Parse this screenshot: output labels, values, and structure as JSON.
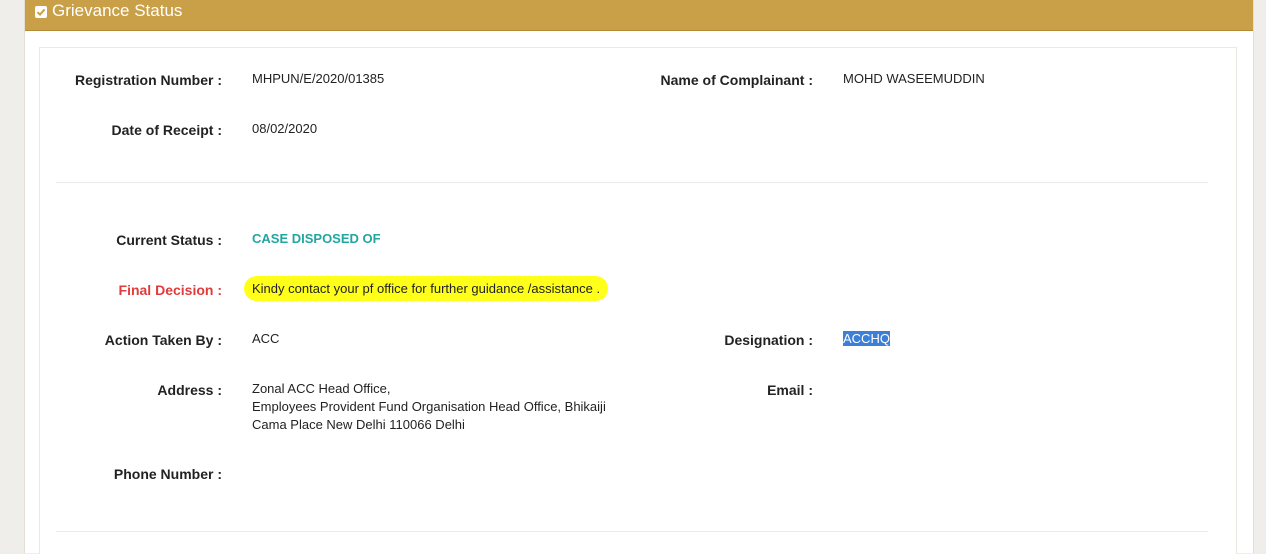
{
  "header": {
    "title": "Grievance Status",
    "icon": "checkbox-icon"
  },
  "fields": {
    "registration_number": {
      "label": "Registration Number :",
      "value": "MHPUN/E/2020/01385"
    },
    "complainant_name": {
      "label": "Name of Complainant :",
      "value": "MOHD WASEEMUDDIN"
    },
    "date_of_receipt": {
      "label": "Date of Receipt :",
      "value": "08/02/2020"
    },
    "current_status": {
      "label": "Current Status :",
      "value": "CASE DISPOSED OF"
    },
    "final_decision": {
      "label": "Final Decision :",
      "value": "Kindy contact your pf office for further guidance /assistance ."
    },
    "action_taken_by": {
      "label": "Action Taken By :",
      "value": "ACC"
    },
    "designation": {
      "label": "Designation :",
      "value": "ACCHQ"
    },
    "address": {
      "label": "Address :",
      "lines": [
        "Zonal ACC Head Office,",
        "Employees Provident Fund Organisation Head Office, Bhikaiji",
        "Cama Place New Delhi 110066 Delhi"
      ]
    },
    "email": {
      "label": "Email :",
      "value": ""
    },
    "phone_number": {
      "label": "Phone Number :",
      "value": ""
    }
  },
  "colors": {
    "header_bg": "#c99f47",
    "status_text": "#22a6a0",
    "final_decision_label": "#e23b3b",
    "highlight": "#ffff1a",
    "selection": "#3b7fd6"
  }
}
